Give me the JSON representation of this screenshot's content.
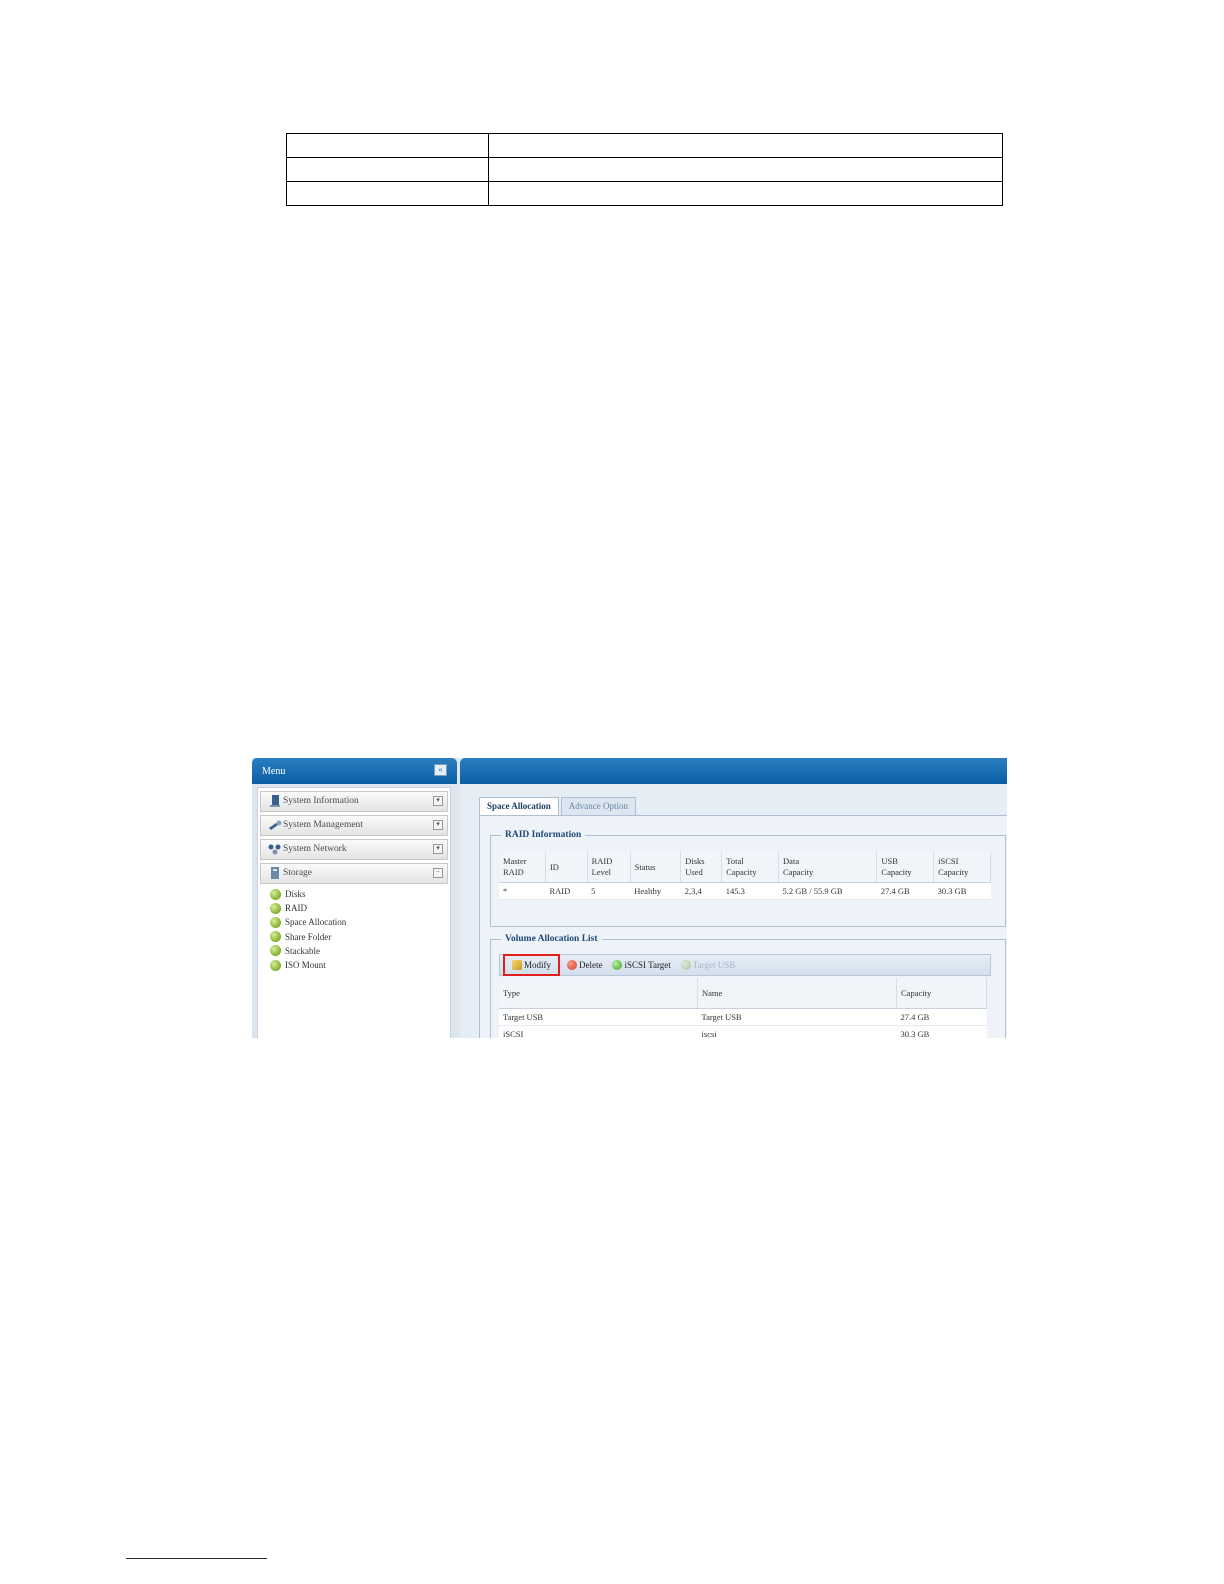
{
  "menu": {
    "title": "Menu",
    "collapse_label": "«",
    "groups": [
      {
        "label": "System Information",
        "toggle": "▾"
      },
      {
        "label": "System Management",
        "toggle": "▾"
      },
      {
        "label": "System Network",
        "toggle": "▾"
      },
      {
        "label": "Storage",
        "toggle": "−"
      }
    ],
    "storage_items": [
      "Disks",
      "RAID",
      "Space Allocation",
      "Share Folder",
      "Stackable",
      "ISO Mount"
    ]
  },
  "tabs": [
    {
      "label": "Space Allocation",
      "active": true
    },
    {
      "label": "Advance Option",
      "active": false
    }
  ],
  "raid_info": {
    "legend": "RAID Information",
    "headers": [
      [
        "Master",
        "RAID"
      ],
      [
        "ID",
        ""
      ],
      [
        "RAID",
        "Level"
      ],
      [
        "Status",
        ""
      ],
      [
        "Disks",
        "Used"
      ],
      [
        "Total",
        "Capacity"
      ],
      [
        "Data",
        "Capacity"
      ],
      [
        "USB",
        "Capacity"
      ],
      [
        "iSCSI",
        "Capacity"
      ]
    ],
    "row": [
      "*",
      "RAID",
      "5",
      "Healthy",
      "2,3,4",
      "145.3",
      "5.2 GB / 55.9 GB",
      "27.4 GB",
      "30.3 GB"
    ]
  },
  "volume_list": {
    "legend": "Volume Allocation List",
    "toolbar": {
      "modify": "Modify",
      "delete": "Delete",
      "iscsi_target": "iSCSI Target",
      "target_usb": "Target USB"
    },
    "headers": [
      "Type",
      "Name",
      "Capacity"
    ],
    "rows": [
      [
        "Target USB",
        "Target USB",
        "27.4 GB"
      ],
      [
        "iSCSI",
        "iscsi",
        "30.3 GB"
      ]
    ]
  },
  "colors": {
    "header_blue": "#0a5da3",
    "highlight_red": "#e02020"
  }
}
